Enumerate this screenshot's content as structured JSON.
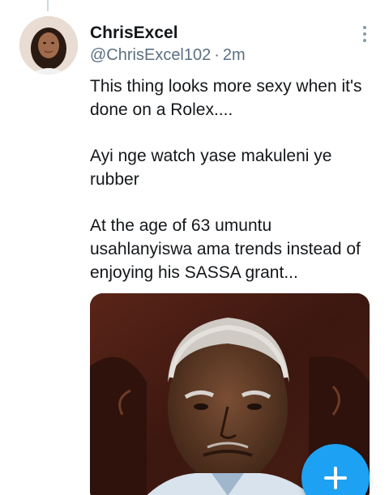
{
  "tweet": {
    "display_name": "ChrisExcel",
    "handle": "@ChrisExcel102",
    "separator": "·",
    "time": "2m",
    "text_paragraphs": [
      "This thing looks more sexy when it's done on a Rolex....",
      "Ayi nge watch yase makuleni ye rubber",
      "At the age of 63 umuntu usahlanyiswa ama trends instead of enjoying his SASSA grant..."
    ],
    "media_icon": "photo-of-elderly-man"
  },
  "icons": {
    "more": "more-vertical-icon",
    "compose": "compose-plus-icon"
  },
  "colors": {
    "accent": "#1da1f2",
    "secondary_text": "#5b7083",
    "primary_text": "#14171a"
  }
}
